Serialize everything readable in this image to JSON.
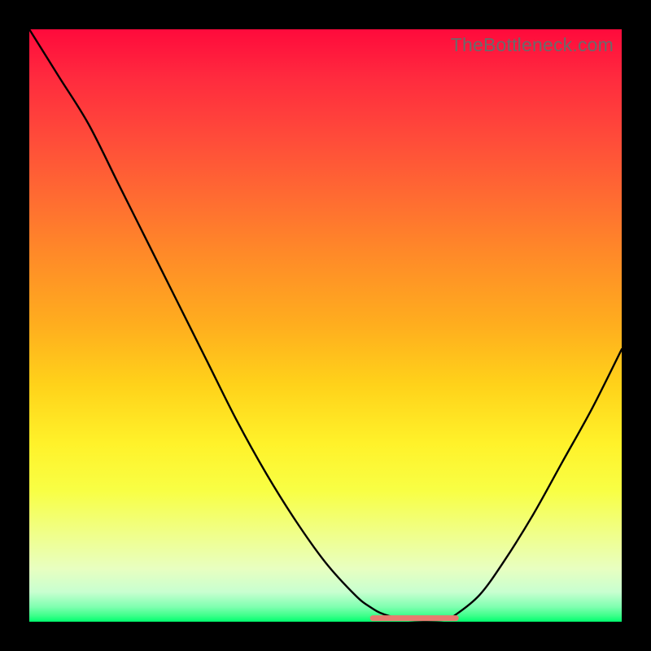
{
  "watermark": "TheBottleneck.com",
  "colors": {
    "flat_segment": "#e87b6f",
    "curve": "#000000",
    "gradient_top": "#ff0a3c",
    "gradient_bottom": "#00ff6e"
  },
  "chart_data": {
    "type": "line",
    "title": "",
    "xlabel": "",
    "ylabel": "",
    "xlim": [
      0,
      1
    ],
    "ylim": [
      0,
      1
    ],
    "x": [
      0.0,
      0.05,
      0.1,
      0.15,
      0.2,
      0.25,
      0.3,
      0.35,
      0.4,
      0.45,
      0.5,
      0.55,
      0.575,
      0.6,
      0.64,
      0.7,
      0.72,
      0.76,
      0.8,
      0.85,
      0.9,
      0.95,
      1.0
    ],
    "y": [
      1.0,
      0.92,
      0.84,
      0.74,
      0.64,
      0.54,
      0.44,
      0.34,
      0.25,
      0.17,
      0.1,
      0.045,
      0.025,
      0.012,
      0.003,
      0.003,
      0.012,
      0.045,
      0.1,
      0.18,
      0.27,
      0.36,
      0.46
    ],
    "flat_segment": {
      "x_start": 0.58,
      "x_end": 0.72,
      "y": 0.006
    },
    "note": "V-shaped bottleneck curve. y=1 is top (red), y=0 is bottom (green). Minimum (best match) around x≈0.64–0.70."
  }
}
